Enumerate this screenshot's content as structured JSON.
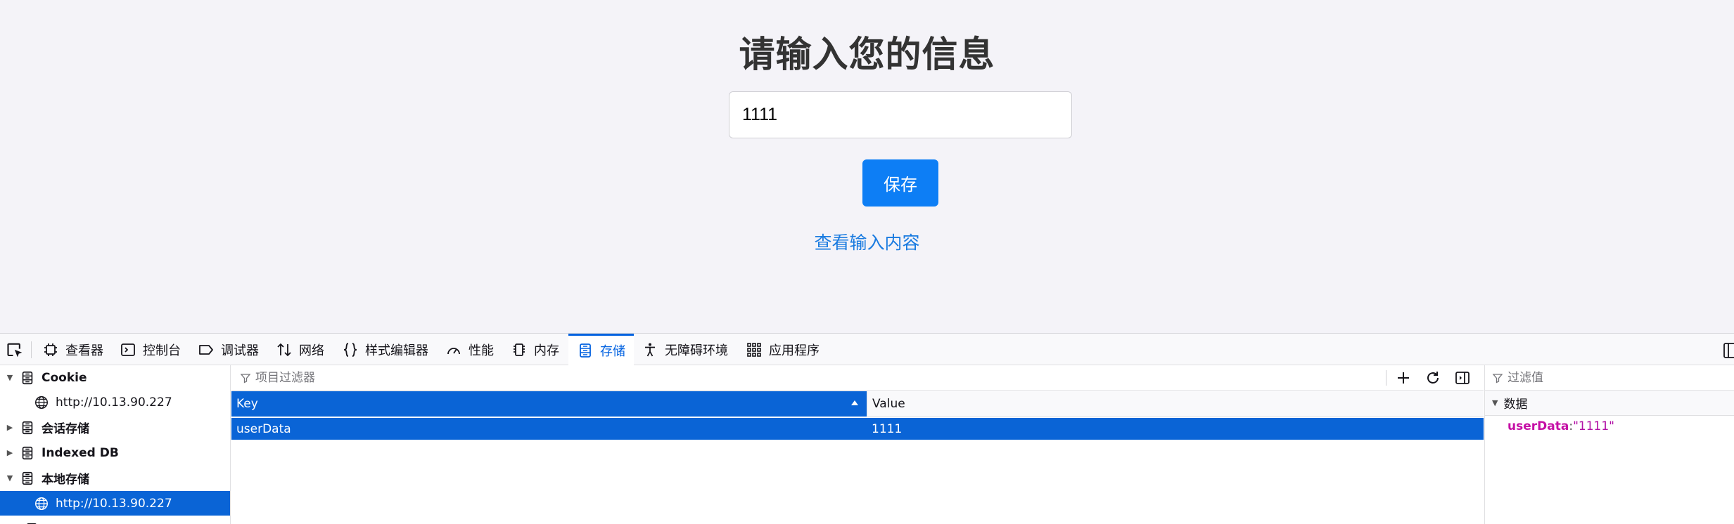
{
  "page": {
    "title": "请输入您的信息",
    "input_value": "1111",
    "save_label": "保存",
    "view_link": "查看输入内容"
  },
  "devtools": {
    "tabs": [
      {
        "label": "查看器",
        "icon": "inspector-icon"
      },
      {
        "label": "控制台",
        "icon": "console-icon"
      },
      {
        "label": "调试器",
        "icon": "debugger-icon"
      },
      {
        "label": "网络",
        "icon": "network-icon"
      },
      {
        "label": "样式编辑器",
        "icon": "style-editor-icon"
      },
      {
        "label": "性能",
        "icon": "performance-icon"
      },
      {
        "label": "内存",
        "icon": "memory-icon"
      },
      {
        "label": "存储",
        "icon": "storage-icon",
        "active": true
      },
      {
        "label": "无障碍环境",
        "icon": "accessibility-icon"
      },
      {
        "label": "应用程序",
        "icon": "application-icon"
      }
    ],
    "tree": [
      {
        "label": "Cookie",
        "expanded": true
      },
      {
        "label": "http://10.13.90.227"
      },
      {
        "label": "会话存储",
        "expanded": false
      },
      {
        "label": "Indexed DB",
        "expanded": false
      },
      {
        "label": "本地存储",
        "expanded": true
      },
      {
        "label": "http://10.13.90.227",
        "selected": true
      }
    ],
    "table": {
      "filter_placeholder": "项目过滤器",
      "columns": [
        "Key",
        "Value"
      ],
      "rows": [
        {
          "key": "userData",
          "value": "1111"
        }
      ]
    },
    "sidebar": {
      "filter_placeholder": "过滤值",
      "section": "数据",
      "item_key": "userData",
      "item_sep": ":",
      "item_value": "\"1111\""
    }
  },
  "colors": {
    "accent": "#0a64d6",
    "button": "#0d7ef5",
    "link": "#1a7be0",
    "page_bg": "#f4f3f8"
  }
}
